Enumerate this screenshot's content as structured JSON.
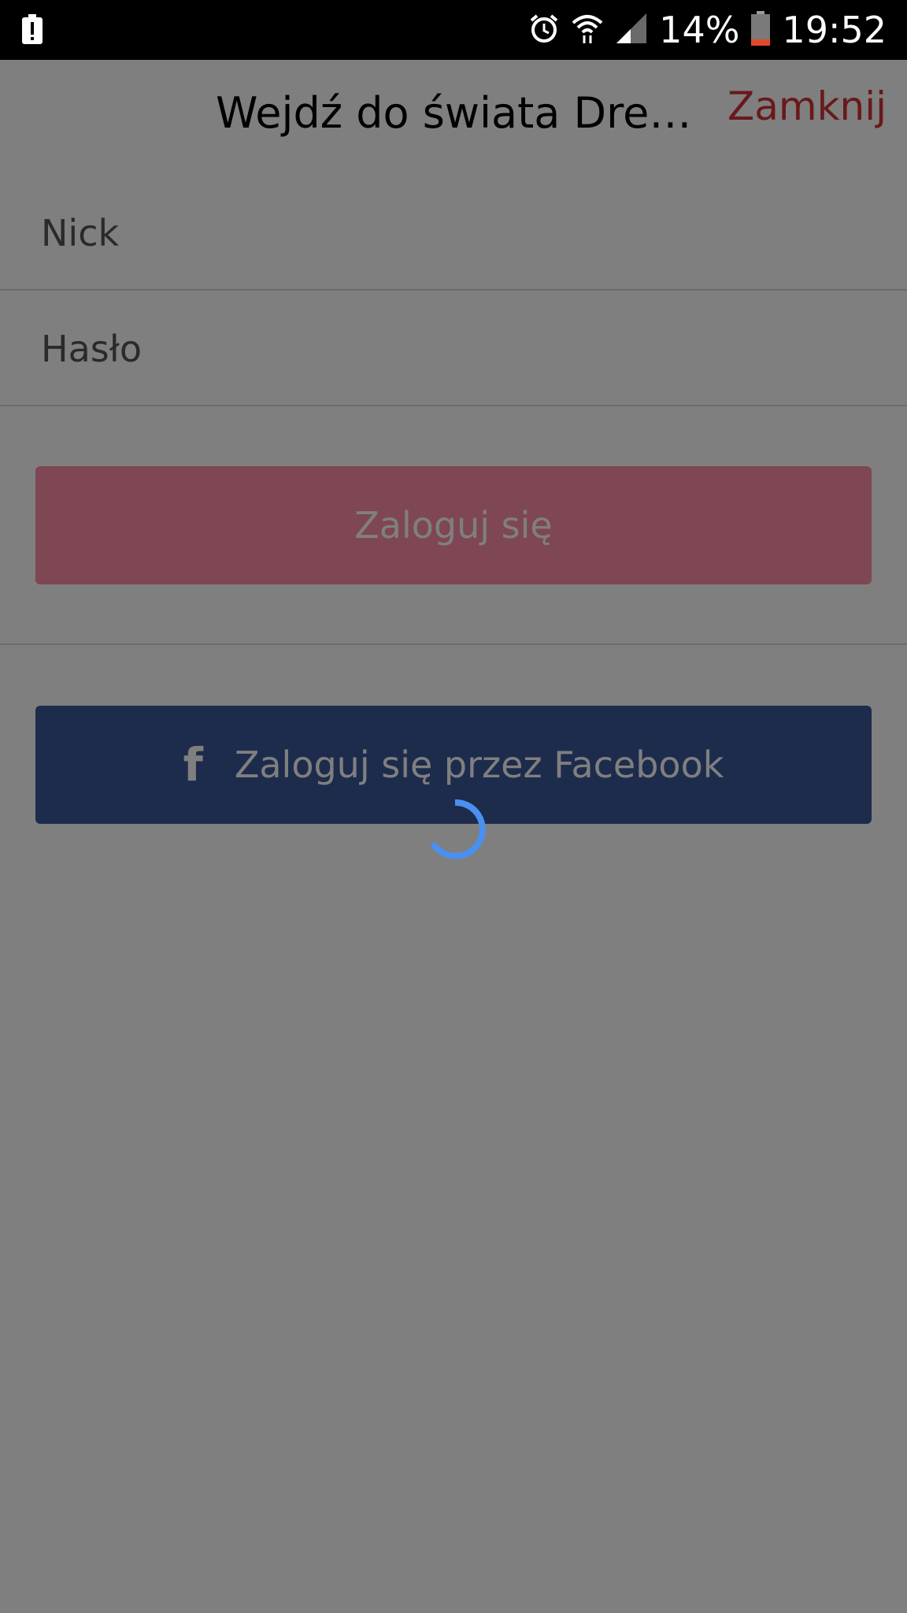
{
  "status_bar": {
    "battery_percent": "14%",
    "time": "19:52",
    "icons": [
      "notification-alert-icon",
      "alarm-icon",
      "wifi-icon",
      "signal-icon",
      "battery-icon"
    ]
  },
  "header": {
    "title": "Wejdź do świata Dress…",
    "close_label": "Zamknij"
  },
  "form": {
    "nick_placeholder": "Nick",
    "password_placeholder": "Hasło",
    "login_label": "Zaloguj się",
    "facebook_label": "Zaloguj się przez Facebook"
  },
  "colors": {
    "close": "#d23237",
    "login_button": "#fe8ca6",
    "facebook_button": "#3b5998",
    "spinner": "#4a90f0",
    "overlay": "rgba(0,0,0,0.5)"
  },
  "loading": true
}
